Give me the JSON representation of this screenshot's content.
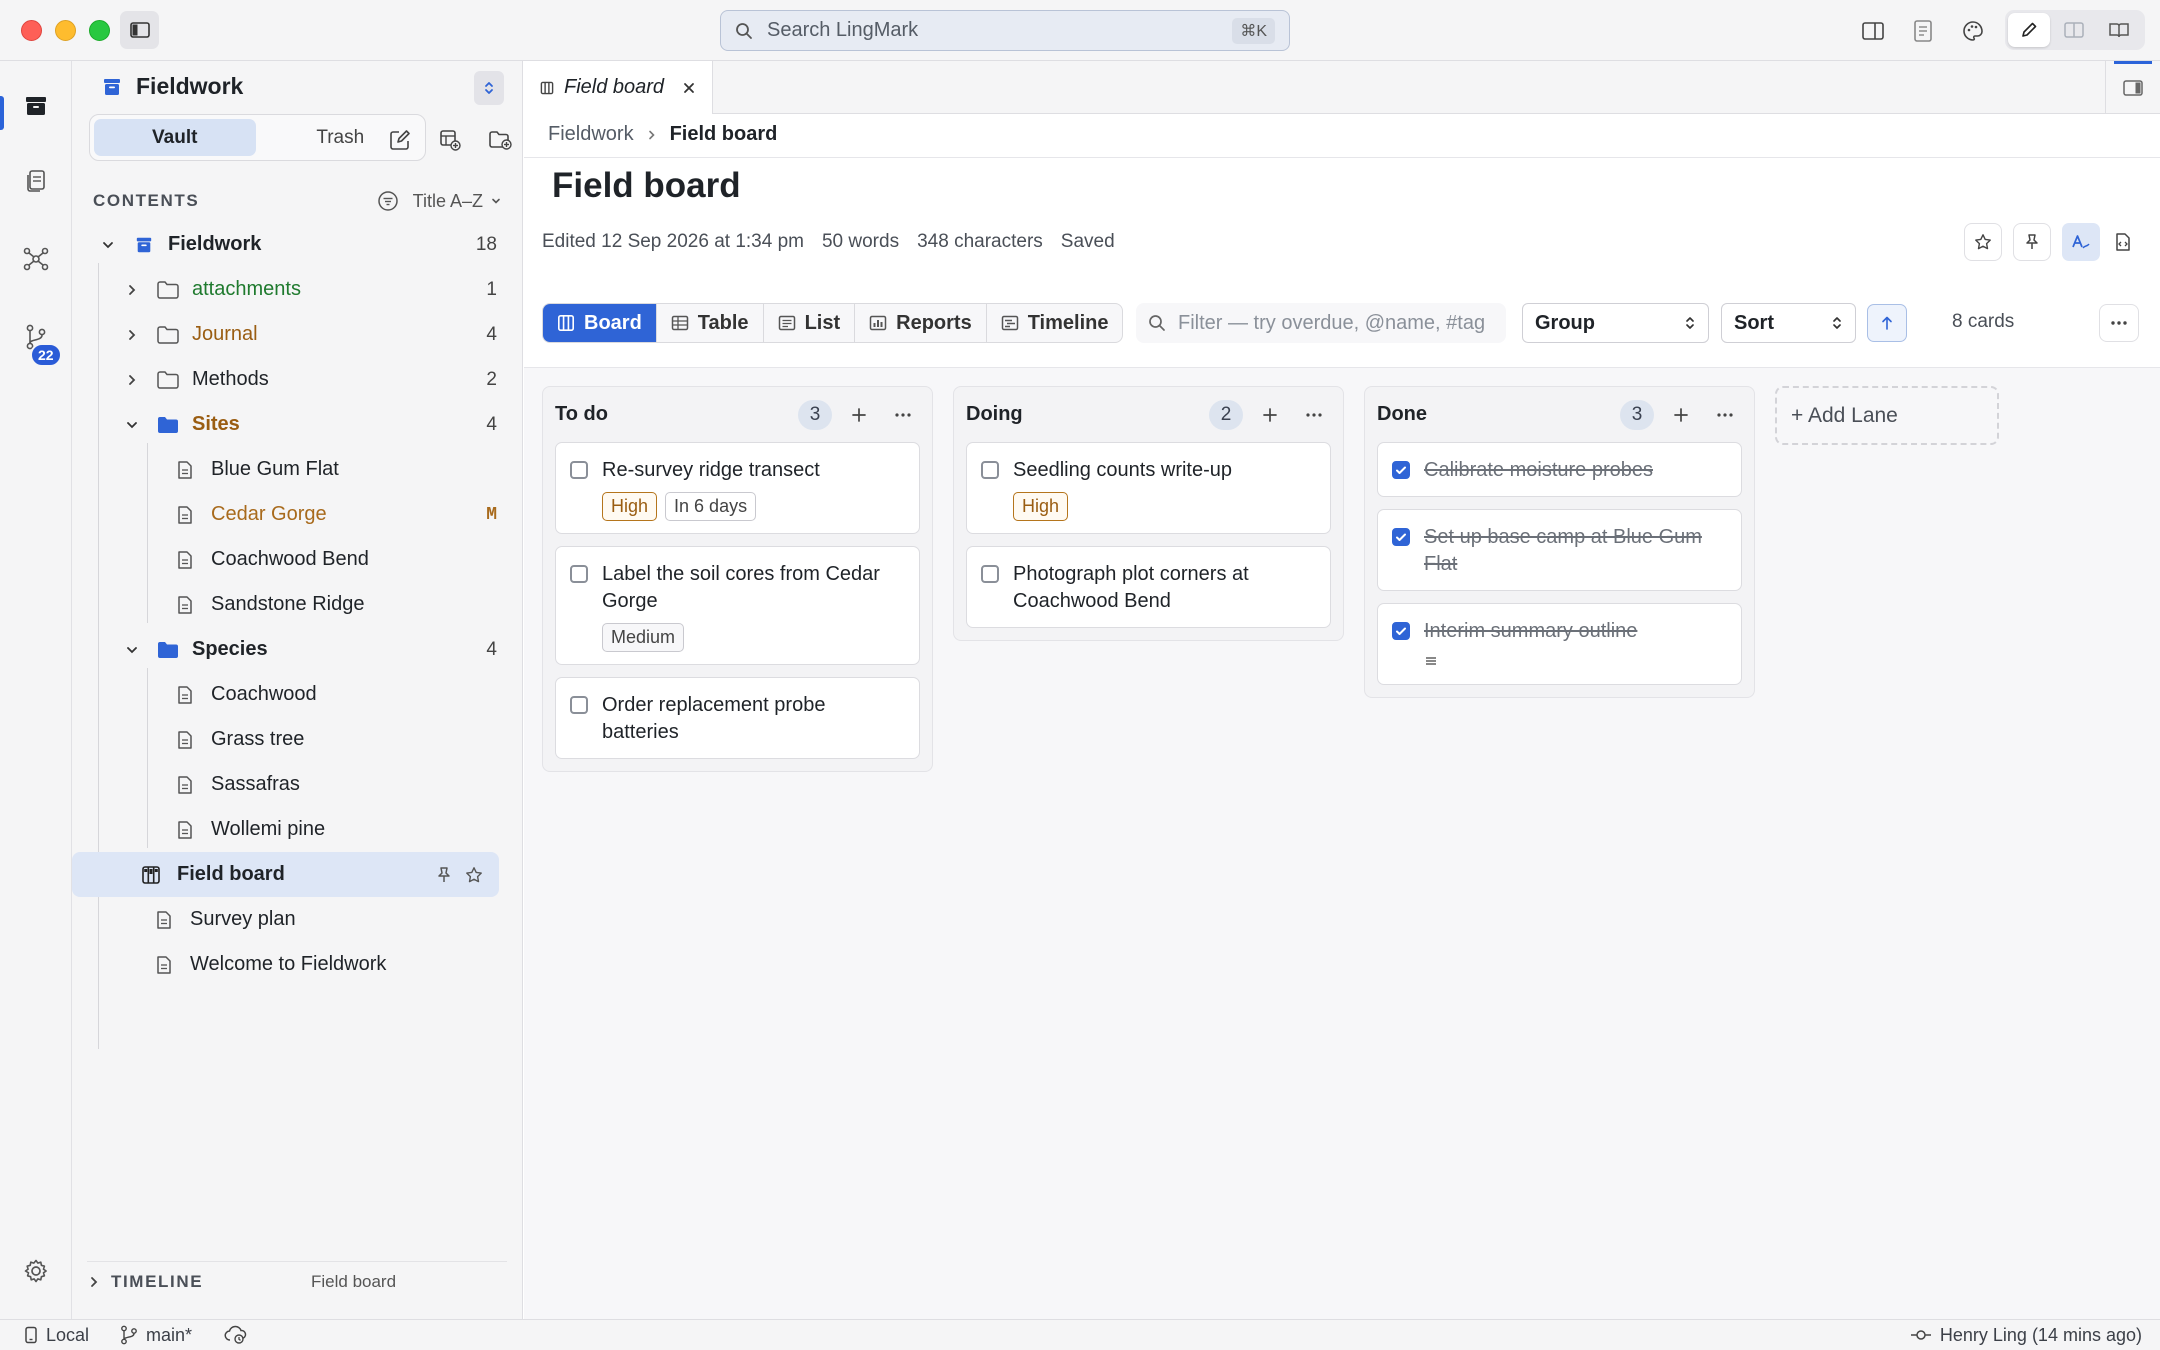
{
  "app": {
    "search_placeholder": "Search LingMark",
    "search_shortcut": "⌘K"
  },
  "rail": {
    "badge_count": "22"
  },
  "sidebar": {
    "vault_name": "Fieldwork",
    "segments": [
      "Vault",
      "Trash"
    ],
    "contents_label": "CONTENTS",
    "sort_label": "Title A–Z",
    "tree": {
      "root": {
        "label": "Fieldwork",
        "count": "18"
      },
      "attachments": {
        "label": "attachments",
        "count": "1"
      },
      "journal": {
        "label": "Journal",
        "count": "4"
      },
      "methods": {
        "label": "Methods",
        "count": "2"
      },
      "sites": {
        "label": "Sites",
        "count": "4"
      },
      "blue_gum_flat": {
        "label": "Blue Gum Flat"
      },
      "cedar_gorge": {
        "label": "Cedar Gorge",
        "status": "M"
      },
      "coachwood_bend": {
        "label": "Coachwood Bend"
      },
      "sandstone_ridge": {
        "label": "Sandstone Ridge"
      },
      "species": {
        "label": "Species",
        "count": "4"
      },
      "coachwood": {
        "label": "Coachwood"
      },
      "grass_tree": {
        "label": "Grass tree"
      },
      "sassafras": {
        "label": "Sassafras"
      },
      "wollemi_pine": {
        "label": "Wollemi pine"
      },
      "field_board": {
        "label": "Field board"
      },
      "survey_plan": {
        "label": "Survey plan"
      },
      "welcome": {
        "label": "Welcome to Fieldwork"
      }
    },
    "timeline_label": "TIMELINE",
    "timeline_file": "Field board"
  },
  "tab": {
    "label": "Field board"
  },
  "breadcrumbs": [
    "Fieldwork",
    "Field board"
  ],
  "page": {
    "title": "Field board",
    "edited": "Edited 12 Sep 2026 at 1:34 pm",
    "words": "50 words",
    "characters": "348 characters",
    "save_state": "Saved"
  },
  "toolbar": {
    "views": [
      "Board",
      "Table",
      "List",
      "Reports",
      "Timeline"
    ],
    "filter_placeholder": "Filter — try overdue, @name, #tag",
    "group_label": "Group",
    "sort_label": "Sort",
    "card_count": "8 cards"
  },
  "board": {
    "add_lane": "+ Add Lane",
    "lanes": [
      {
        "title": "To do",
        "count": "3",
        "cards": [
          {
            "title": "Re-survey ridge transect",
            "tags": [
              "High",
              "In 6 days"
            ]
          },
          {
            "title": "Label the soil cores from Cedar Gorge",
            "tags": [
              "Medium"
            ]
          },
          {
            "title": "Order replacement probe batteries"
          }
        ]
      },
      {
        "title": "Doing",
        "count": "2",
        "cards": [
          {
            "title": "Seedling counts write-up",
            "tags": [
              "High"
            ]
          },
          {
            "title": "Photograph plot corners at Coachwood Bend"
          }
        ]
      },
      {
        "title": "Done",
        "count": "3",
        "cards": [
          {
            "title": "Calibrate moisture probes"
          },
          {
            "title": "Set up base camp at Blue Gum Flat"
          },
          {
            "title": "Interim summary outline"
          }
        ]
      }
    ]
  },
  "statusbar": {
    "location": "Local",
    "branch": "main*",
    "author": "Henry Ling (14 mins ago)"
  },
  "colors": {
    "accent": "#2f64d6",
    "folder_green": "#1f7a2e",
    "folder_brown": "#9a5d12",
    "modified": "#a86a1c"
  }
}
